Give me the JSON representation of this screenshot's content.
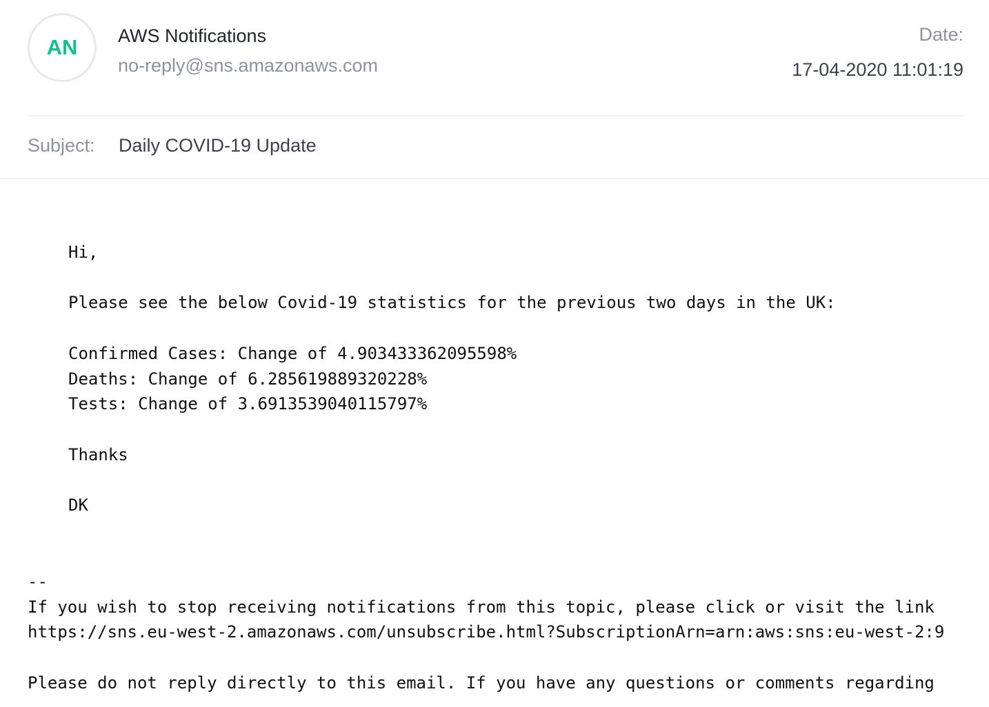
{
  "header": {
    "avatar_initials": "AN",
    "sender_name": "AWS Notifications",
    "sender_email": "no-reply@sns.amazonaws.com",
    "date_label": "Date:",
    "date_value": "17-04-2020 11:01:19",
    "subject_label": "Subject:",
    "subject_value": "Daily COVID-19 Update"
  },
  "body": {
    "greeting": "Hi,",
    "intro": "Please see the below Covid-19 statistics for the previous two days in the UK:",
    "stats": [
      "Confirmed Cases: Change of 4.903433362095598%",
      "Deaths: Change of 6.285619889320228%",
      "Tests: Change of 3.6913539040115797%"
    ],
    "thanks": "Thanks",
    "signature": "DK"
  },
  "footer": {
    "separator": "--",
    "unsubscribe_text": "If you wish to stop receiving notifications from this topic, please click or visit the link",
    "unsubscribe_link": "https://sns.eu-west-2.amazonaws.com/unsubscribe.html?SubscriptionArn=arn:aws:sns:eu-west-2:9",
    "no_reply_notice": "Please do not reply directly to this email. If you have any questions or comments regarding"
  },
  "colors": {
    "avatar_text": "#10c28f",
    "muted_text": "#8a93a6",
    "divider": "#eef0f3"
  }
}
